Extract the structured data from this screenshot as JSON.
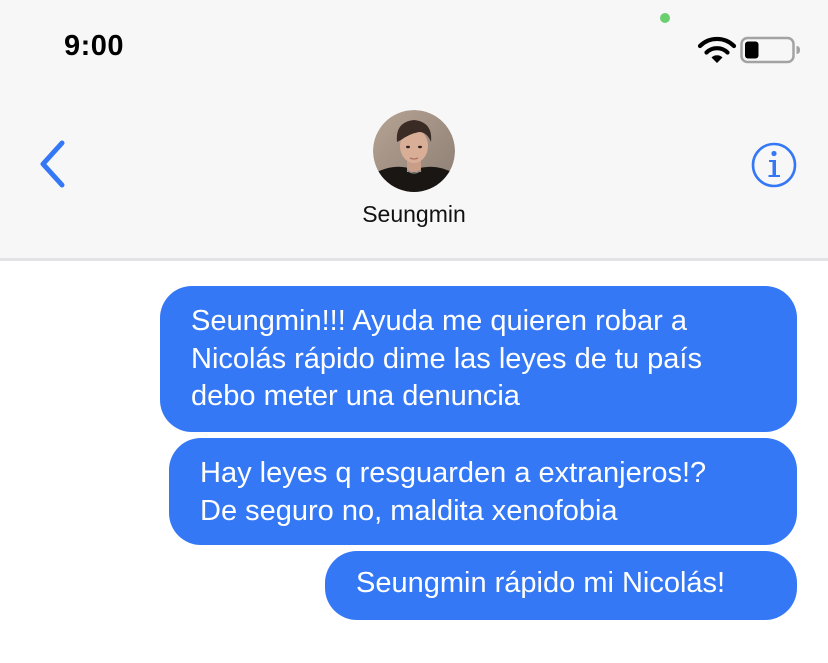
{
  "status_bar": {
    "time": "9:00",
    "icons": [
      "privacy-indicator-dot",
      "wifi-icon",
      "battery-icon"
    ],
    "battery_level": 0.3
  },
  "header": {
    "back_icon": "chevron-left-icon",
    "contact_name": "Seungmin",
    "info_icon": "info-circle-icon"
  },
  "messages": [
    {
      "direction": "outgoing",
      "text": "Seungmin!!! Ayuda me quieren robar a\nNicolás rápido dime las leyes de tu país\ndebo meter una denuncia"
    },
    {
      "direction": "outgoing",
      "text": "Hay leyes q resguarden a extranjeros!?\nDe seguro no, maldita xenofobia"
    },
    {
      "direction": "outgoing",
      "text": "Seungmin rápido mi Nicolás!"
    }
  ],
  "colors": {
    "accent": "#3478f6",
    "header_bg": "#f7f7f8",
    "divider": "#e3e3e6",
    "indicator_green": "#6ad06f"
  }
}
